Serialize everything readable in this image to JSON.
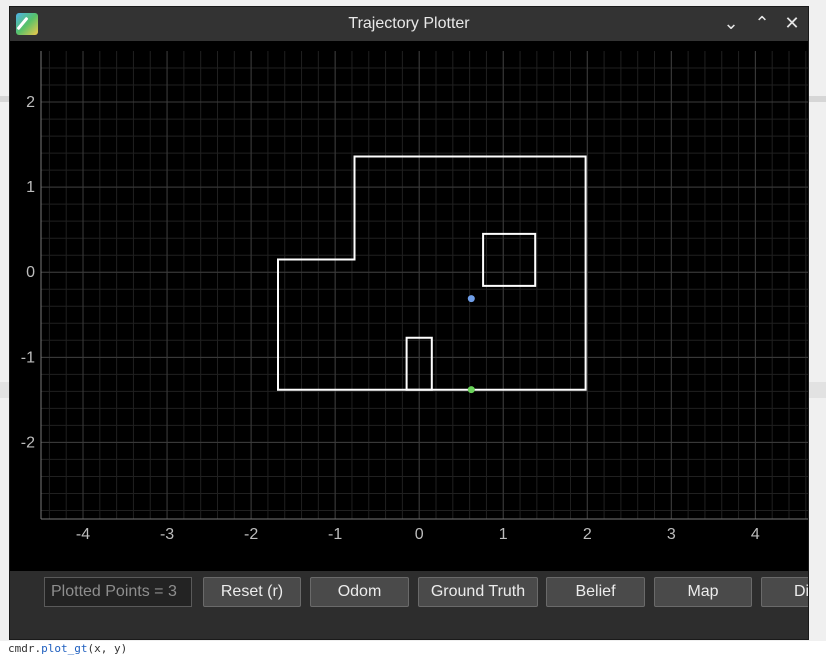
{
  "window": {
    "title": "Trajectory Plotter",
    "controls": [
      "minimize",
      "maximize",
      "close"
    ]
  },
  "toolbar": {
    "plotted_points_label": "Plotted Points = 3",
    "buttons": [
      {
        "label": "Reset (r)"
      },
      {
        "label": "Odom"
      },
      {
        "label": "Ground Truth"
      },
      {
        "label": "Belief"
      },
      {
        "label": "Map"
      },
      {
        "label": "Di"
      }
    ]
  },
  "background": {
    "bottom_text_prefix": "cmdr.",
    "bottom_text_fn": "plot_gt",
    "bottom_text_suffix": "(x, y)"
  },
  "chart_data": {
    "type": "scatter",
    "xlim": [
      -4.5,
      4.65
    ],
    "ylim": [
      -2.9,
      2.6
    ],
    "x_ticks": [
      -4,
      -3,
      -2,
      -1,
      0,
      1,
      2,
      3,
      4
    ],
    "y_ticks": [
      -2,
      -1,
      0,
      1,
      2
    ],
    "grid": true,
    "map_polygon": [
      [
        -1.68,
        0.15
      ],
      [
        -0.77,
        0.15
      ],
      [
        -0.77,
        1.36
      ],
      [
        1.98,
        1.36
      ],
      [
        1.98,
        -1.38
      ],
      [
        -1.68,
        -1.38
      ]
    ],
    "obstacles": [
      [
        [
          0.76,
          0.45
        ],
        [
          1.38,
          0.45
        ],
        [
          1.38,
          -0.16
        ],
        [
          0.76,
          -0.16
        ]
      ],
      [
        [
          -0.15,
          -0.77
        ],
        [
          0.15,
          -0.77
        ],
        [
          0.15,
          -1.38
        ],
        [
          -0.15,
          -1.38
        ]
      ]
    ],
    "points": [
      {
        "x": 0.62,
        "y": -0.31,
        "color": "#6f9ee8"
      },
      {
        "x": 0.62,
        "y": -1.38,
        "color": "#6ad35a"
      }
    ],
    "colors": {
      "map": "#ffffff",
      "grid_major": "#3c3c3c",
      "grid_minor": "#202020",
      "tick": "#bdbdbd"
    }
  }
}
